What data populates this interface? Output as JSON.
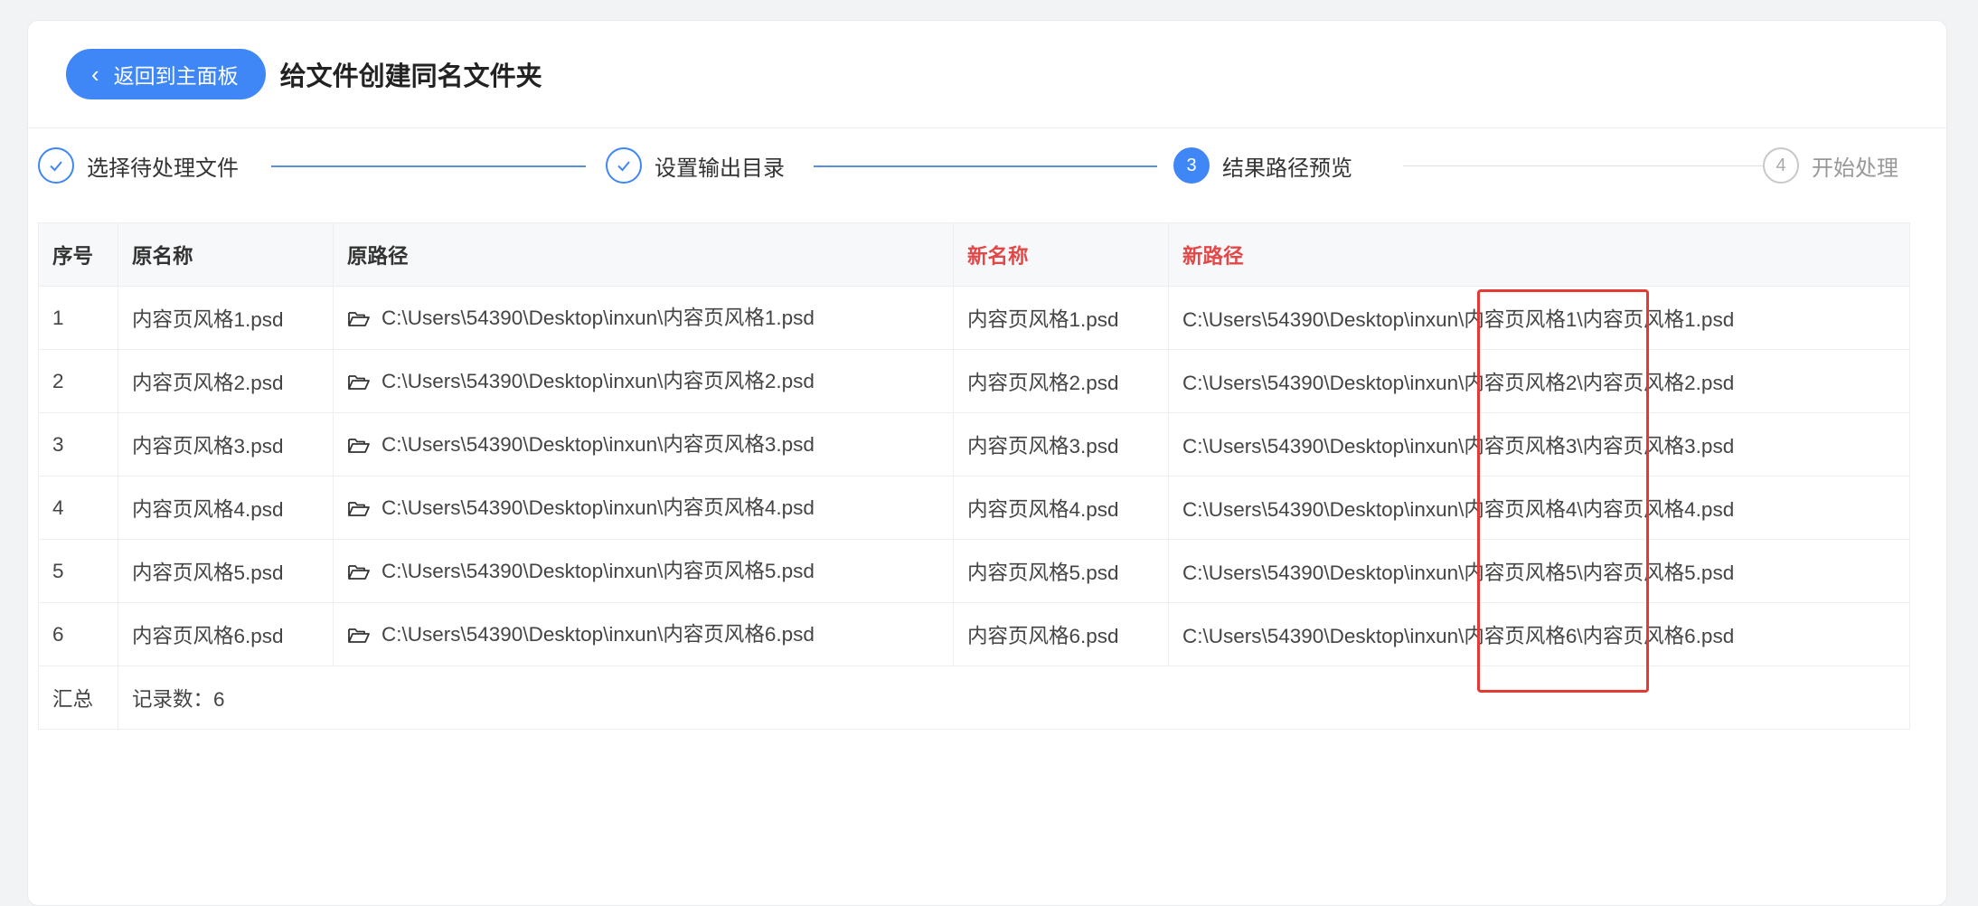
{
  "header": {
    "back_label": "返回到主面板",
    "title": "给文件创建同名文件夹"
  },
  "steps": [
    {
      "label": "选择待处理文件",
      "state": "done"
    },
    {
      "label": "设置输出目录",
      "state": "done"
    },
    {
      "number": "3",
      "label": "结果路径预览",
      "state": "active"
    },
    {
      "number": "4",
      "label": "开始处理",
      "state": "pending"
    }
  ],
  "table": {
    "headers": {
      "index": "序号",
      "orig_name": "原名称",
      "orig_path": "原路径",
      "new_name": "新名称",
      "new_path": "新路径"
    },
    "rows": [
      {
        "index": "1",
        "orig_name": "内容页风格1.psd",
        "orig_path": "C:\\Users\\54390\\Desktop\\inxun\\内容页风格1.psd",
        "new_name": "内容页风格1.psd",
        "new_path": "C:\\Users\\54390\\Desktop\\inxun\\内容页风格1\\内容页风格1.psd"
      },
      {
        "index": "2",
        "orig_name": "内容页风格2.psd",
        "orig_path": "C:\\Users\\54390\\Desktop\\inxun\\内容页风格2.psd",
        "new_name": "内容页风格2.psd",
        "new_path": "C:\\Users\\54390\\Desktop\\inxun\\内容页风格2\\内容页风格2.psd"
      },
      {
        "index": "3",
        "orig_name": "内容页风格3.psd",
        "orig_path": "C:\\Users\\54390\\Desktop\\inxun\\内容页风格3.psd",
        "new_name": "内容页风格3.psd",
        "new_path": "C:\\Users\\54390\\Desktop\\inxun\\内容页风格3\\内容页风格3.psd"
      },
      {
        "index": "4",
        "orig_name": "内容页风格4.psd",
        "orig_path": "C:\\Users\\54390\\Desktop\\inxun\\内容页风格4.psd",
        "new_name": "内容页风格4.psd",
        "new_path": "C:\\Users\\54390\\Desktop\\inxun\\内容页风格4\\内容页风格4.psd"
      },
      {
        "index": "5",
        "orig_name": "内容页风格5.psd",
        "orig_path": "C:\\Users\\54390\\Desktop\\inxun\\内容页风格5.psd",
        "new_name": "内容页风格5.psd",
        "new_path": "C:\\Users\\54390\\Desktop\\inxun\\内容页风格5\\内容页风格5.psd"
      },
      {
        "index": "6",
        "orig_name": "内容页风格6.psd",
        "orig_path": "C:\\Users\\54390\\Desktop\\inxun\\内容页风格6.psd",
        "new_name": "内容页风格6.psd",
        "new_path": "C:\\Users\\54390\\Desktop\\inxun\\内容页风格6\\内容页风格6.psd"
      }
    ],
    "summary": {
      "label": "汇总",
      "value": "记录数：6"
    }
  },
  "colors": {
    "accent": "#3f86f7",
    "new_column_header": "#e34848",
    "highlight_box": "#e53935"
  }
}
